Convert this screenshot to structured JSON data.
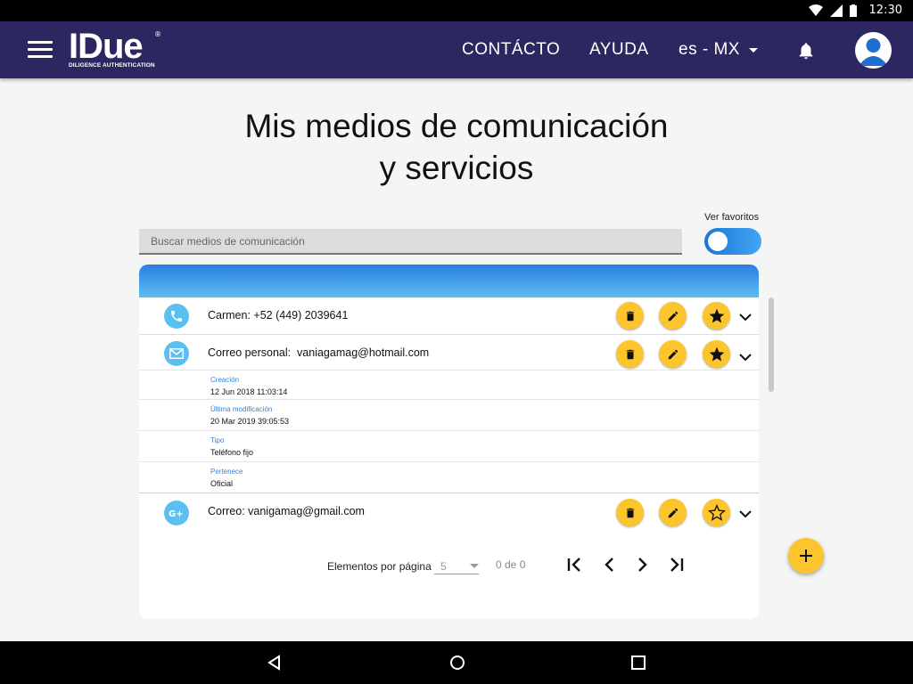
{
  "status_bar": {
    "time": "12:30"
  },
  "header": {
    "logo_text": "IDue",
    "logo_sub": "DILIGENCE AUTHENTICATION",
    "logo_reg": "®",
    "nav": [
      {
        "label": "CONTÁCTO"
      },
      {
        "label": "AYUDA"
      }
    ],
    "language": "es - MX"
  },
  "page": {
    "title_line1": "Mis medios de comunicación",
    "title_line2": "y servicios"
  },
  "search": {
    "placeholder": "Buscar medios de comunicación",
    "value": ""
  },
  "favorites": {
    "label": "Ver favoritos",
    "enabled": true
  },
  "items": [
    {
      "icon": "phone-icon",
      "label": "Carmen: +52 (449) 2039641",
      "favorite": true,
      "expanded": false
    },
    {
      "icon": "mail-icon",
      "label": "Correo personal:  vaniagamag@hotmail.com",
      "favorite": true,
      "expanded": true,
      "details": [
        {
          "key": "Creación",
          "value": "12 Jun 2018 11:03:14"
        },
        {
          "key": "Última modificación",
          "value": "20 Mar 2019 39:05:53"
        },
        {
          "key": "Tipo",
          "value": "Teléfono fijo"
        },
        {
          "key": "Pertenece",
          "value": "Oficial"
        }
      ]
    },
    {
      "icon": "google-plus-icon",
      "label": "Correo: vanigamag@gmail.com",
      "favorite": false,
      "expanded": false
    }
  ],
  "pagination": {
    "label": "Elementos por página",
    "page_size": "5",
    "range": "0 de 0"
  },
  "colors": {
    "app_bar": "#2c2661",
    "accent_yellow": "#fcc52d",
    "accent_blue": "#5bc0ef"
  }
}
